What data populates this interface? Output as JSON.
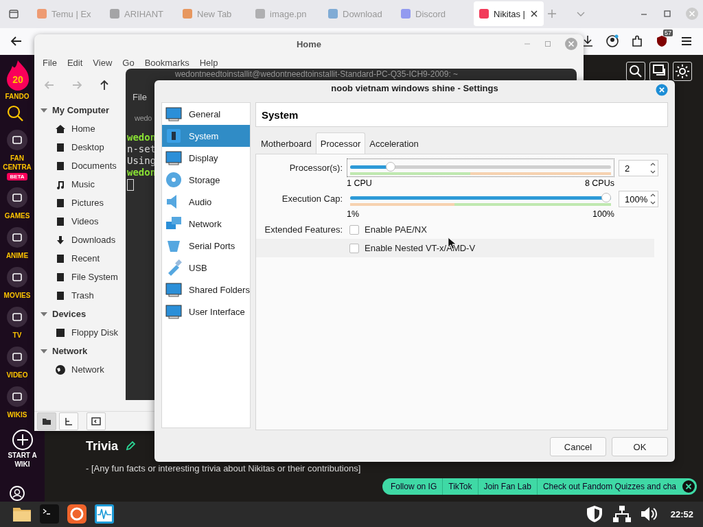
{
  "browser": {
    "tabs": [
      {
        "title": "Temu | Ex",
        "selected": false
      },
      {
        "title": "ARIHANT",
        "selected": false
      },
      {
        "title": "New Tab",
        "selected": false
      },
      {
        "title": "image.pn",
        "selected": false
      },
      {
        "title": "Download",
        "selected": false
      },
      {
        "title": "Discord",
        "selected": false
      },
      {
        "title": "Nikitas |",
        "selected": true
      }
    ],
    "extension_badge": "57"
  },
  "fandom": {
    "logo": "20",
    "rail": [
      {
        "kind": "search"
      },
      {
        "kind": "item",
        "lines": [
          "FAN",
          "CENTRA"
        ],
        "badge": "BETA"
      },
      {
        "kind": "item",
        "lines": [
          "GAMES"
        ]
      },
      {
        "kind": "item",
        "lines": [
          "ANIME"
        ]
      },
      {
        "kind": "item",
        "lines": [
          "MOVIES"
        ]
      },
      {
        "kind": "item",
        "lines": [
          "TV"
        ]
      },
      {
        "kind": "item",
        "lines": [
          "VIDEO"
        ]
      },
      {
        "kind": "item",
        "lines": [
          "WIKIS"
        ]
      },
      {
        "kind": "start",
        "lines": [
          "START A",
          "WIKI"
        ]
      },
      {
        "kind": "user"
      }
    ],
    "logo_label": "FANDO",
    "section_title": "Trivia",
    "section_text": "- [Any fun facts or interesting trivia about Nikitas or their contributions]",
    "banner": [
      "Follow on IG",
      "TikTok",
      "Join Fan Lab",
      "Check out Fandom Quizzes and cha"
    ]
  },
  "file_manager": {
    "title": "Home",
    "menu": [
      "File",
      "Edit",
      "View",
      "Go",
      "Bookmarks",
      "Help"
    ],
    "sidebar": [
      {
        "label": "My Computer",
        "expanded": true,
        "children": [
          {
            "label": "Home"
          },
          {
            "label": "Desktop"
          },
          {
            "label": "Documents"
          },
          {
            "label": "Music"
          },
          {
            "label": "Pictures"
          },
          {
            "label": "Videos"
          },
          {
            "label": "Downloads"
          },
          {
            "label": "Recent"
          },
          {
            "label": "File System"
          },
          {
            "label": "Trash"
          }
        ]
      },
      {
        "label": "Devices",
        "expanded": true,
        "children": [
          {
            "label": "Floppy Disk"
          }
        ]
      },
      {
        "label": "Network",
        "expanded": true,
        "children": [
          {
            "label": "Network"
          }
        ]
      }
    ]
  },
  "terminal": {
    "title": "wedontneedtoinstallit@wedontneedtoinstallit-Standard-PC-Q35-ICH9-2009: ~",
    "menu": "File",
    "tab": "wedo",
    "lines": [
      {
        "text": "wedon",
        "kind": "prompt"
      },
      {
        "text": "n-set",
        "kind": "output"
      },
      {
        "text": "Using",
        "kind": "output"
      },
      {
        "text": "wedon",
        "kind": "prompt"
      }
    ]
  },
  "settings": {
    "title": "noob vietnam windows shine - Settings",
    "nav": [
      {
        "label": "General",
        "selected": false
      },
      {
        "label": "System",
        "selected": true
      },
      {
        "label": "Display",
        "selected": false
      },
      {
        "label": "Storage",
        "selected": false
      },
      {
        "label": "Audio",
        "selected": false
      },
      {
        "label": "Network",
        "selected": false
      },
      {
        "label": "Serial Ports",
        "selected": false
      },
      {
        "label": "USB",
        "selected": false
      },
      {
        "label": "Shared Folders",
        "selected": false
      },
      {
        "label": "User Interface",
        "selected": false
      }
    ],
    "page_title": "System",
    "tabs": [
      {
        "label": "Motherboard",
        "selected": false
      },
      {
        "label": "Processor",
        "selected": true
      },
      {
        "label": "Acceleration",
        "selected": false
      }
    ],
    "sliders": [
      {
        "label": "Processor(s):",
        "level": 0.143,
        "value": "2",
        "min_label": "1 CPU",
        "max_label": "8 CPUs"
      },
      {
        "label": "Execution Cap:",
        "level": 1.0,
        "value": "100%",
        "min_label": "1%",
        "max_label": "100%"
      }
    ],
    "extended_label": "Extended Features:",
    "features": [
      {
        "label": "Enable PAE/NX",
        "checked": false
      },
      {
        "label": "Enable Nested VT-x/AMD-V",
        "checked": false
      }
    ],
    "buttons": [
      "Cancel",
      "OK"
    ]
  },
  "taskbar": {
    "clock": "22:52"
  }
}
